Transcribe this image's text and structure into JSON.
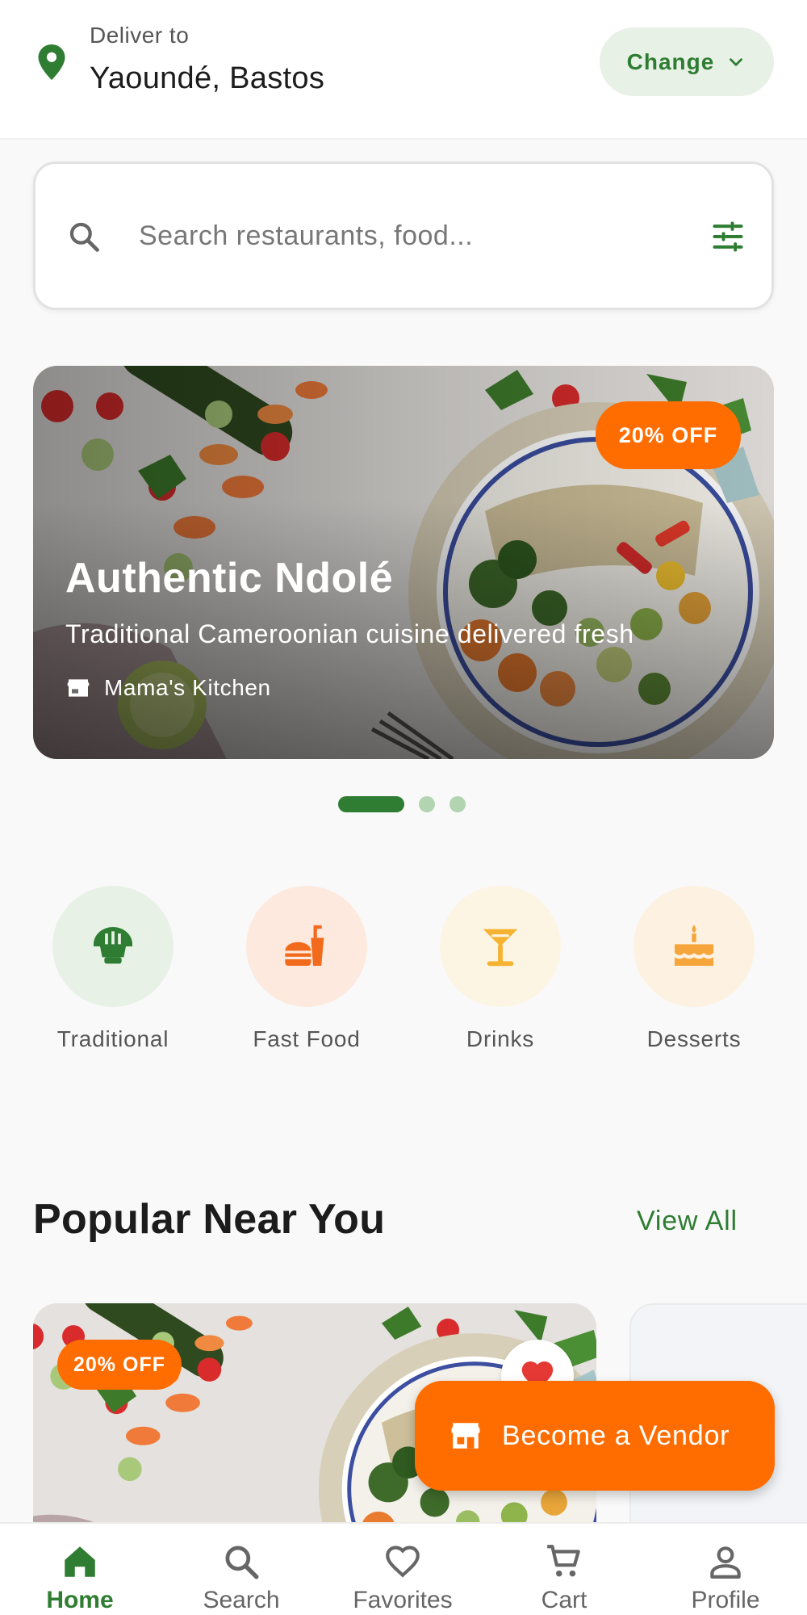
{
  "header": {
    "deliver_label": "Deliver to",
    "address": "Yaoundé, Bastos",
    "change_label": "Change"
  },
  "search": {
    "placeholder": "Search restaurants, food..."
  },
  "banner": {
    "badge": "20% OFF",
    "title": "Authentic Ndolé",
    "subtitle": "Traditional Cameroonian cuisine delivered fresh",
    "store": "Mama's Kitchen",
    "active_slide": 1,
    "slide_count": 3
  },
  "categories": [
    {
      "label": "Traditional",
      "icon": "rice-bowl-icon",
      "bg": "#e8f1e6",
      "color": "#2e7d32"
    },
    {
      "label": "Fast Food",
      "icon": "fastfood-icon",
      "bg": "#fde9de",
      "color": "#f26a1b"
    },
    {
      "label": "Drinks",
      "icon": "cocktail-icon",
      "bg": "#fdf5e4",
      "color": "#f5b331"
    },
    {
      "label": "Desserts",
      "icon": "cake-icon",
      "bg": "#fdf1e1",
      "color": "#f5a53a"
    }
  ],
  "popular": {
    "title": "Popular Near You",
    "view_all": "View All",
    "card_badge": "20% OFF"
  },
  "fab": {
    "label": "Become a Vendor"
  },
  "nav": {
    "items": [
      {
        "label": "Home",
        "icon": "home-icon"
      },
      {
        "label": "Search",
        "icon": "search-icon"
      },
      {
        "label": "Favorites",
        "icon": "heart-icon"
      },
      {
        "label": "Cart",
        "icon": "cart-icon"
      },
      {
        "label": "Profile",
        "icon": "person-icon"
      }
    ],
    "active": "Home"
  },
  "colors": {
    "primary": "#2e7d32",
    "accent": "#ff6d00",
    "favorite": "#e53935"
  }
}
